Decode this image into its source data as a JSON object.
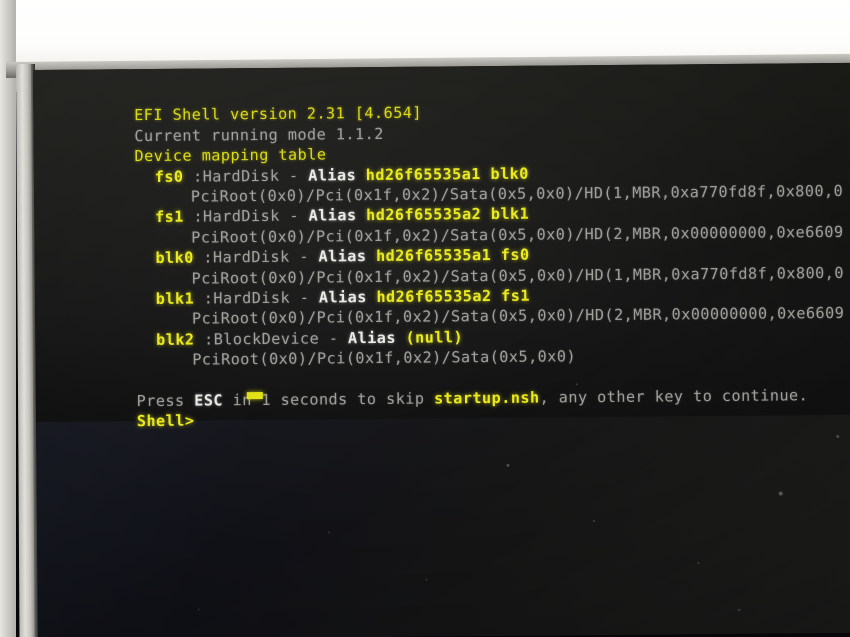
{
  "screen": {
    "header": {
      "shell_version_line": "EFI Shell version 2.31 [4.654]",
      "running_mode_line": "Current running mode 1.1.2",
      "mapping_table_title": "Device mapping table"
    },
    "device_mappings": [
      {
        "name": "fs0",
        "separator": ":",
        "type": "HardDisk",
        "dash": "-",
        "alias_label": "Alias",
        "alias_value": "hd26f65535a1 blk0",
        "device_path": "PciRoot(0x0)/Pci(0x1f,0x2)/Sata(0x5,0x0)/HD(1,MBR,0xa770fd8f,0x800,0"
      },
      {
        "name": "fs1",
        "separator": ":",
        "type": "HardDisk",
        "dash": "-",
        "alias_label": "Alias",
        "alias_value": "hd26f65535a2 blk1",
        "device_path": "PciRoot(0x0)/Pci(0x1f,0x2)/Sata(0x5,0x0)/HD(2,MBR,0x00000000,0xe6609"
      },
      {
        "name": "blk0",
        "separator": ":",
        "type": "HardDisk",
        "dash": "-",
        "alias_label": "Alias",
        "alias_value": "hd26f65535a1 fs0",
        "device_path": "PciRoot(0x0)/Pci(0x1f,0x2)/Sata(0x5,0x0)/HD(1,MBR,0xa770fd8f,0x800,0"
      },
      {
        "name": "blk1",
        "separator": ":",
        "type": "HardDisk",
        "dash": "-",
        "alias_label": "Alias",
        "alias_value": "hd26f65535a2 fs1",
        "device_path": "PciRoot(0x0)/Pci(0x1f,0x2)/Sata(0x5,0x0)/HD(2,MBR,0x00000000,0xe6609"
      },
      {
        "name": "blk2",
        "separator": ":",
        "type": "BlockDevice",
        "dash": "-",
        "alias_label": "Alias",
        "alias_value": "(null)",
        "device_path": "PciRoot(0x0)/Pci(0x1f,0x2)/Sata(0x5,0x0)"
      }
    ],
    "startup_prompt": {
      "part1": "Press ",
      "key": "ESC",
      "part2": " in 1 seconds to skip ",
      "script": "startup.nsh",
      "part3": ", any other key to continue.",
      "timeout_seconds": "1"
    },
    "shell_prompt": {
      "prompt": "Shell>",
      "input_value": "",
      "cursor": "block-cursor"
    },
    "colors": {
      "background": "#0d0d0c",
      "yellow": "#d7d714",
      "bright_yellow": "#e8e81d",
      "gray": "#9c9c98",
      "white": "#e9e9e6",
      "bezel": "#c4c2bc"
    }
  }
}
